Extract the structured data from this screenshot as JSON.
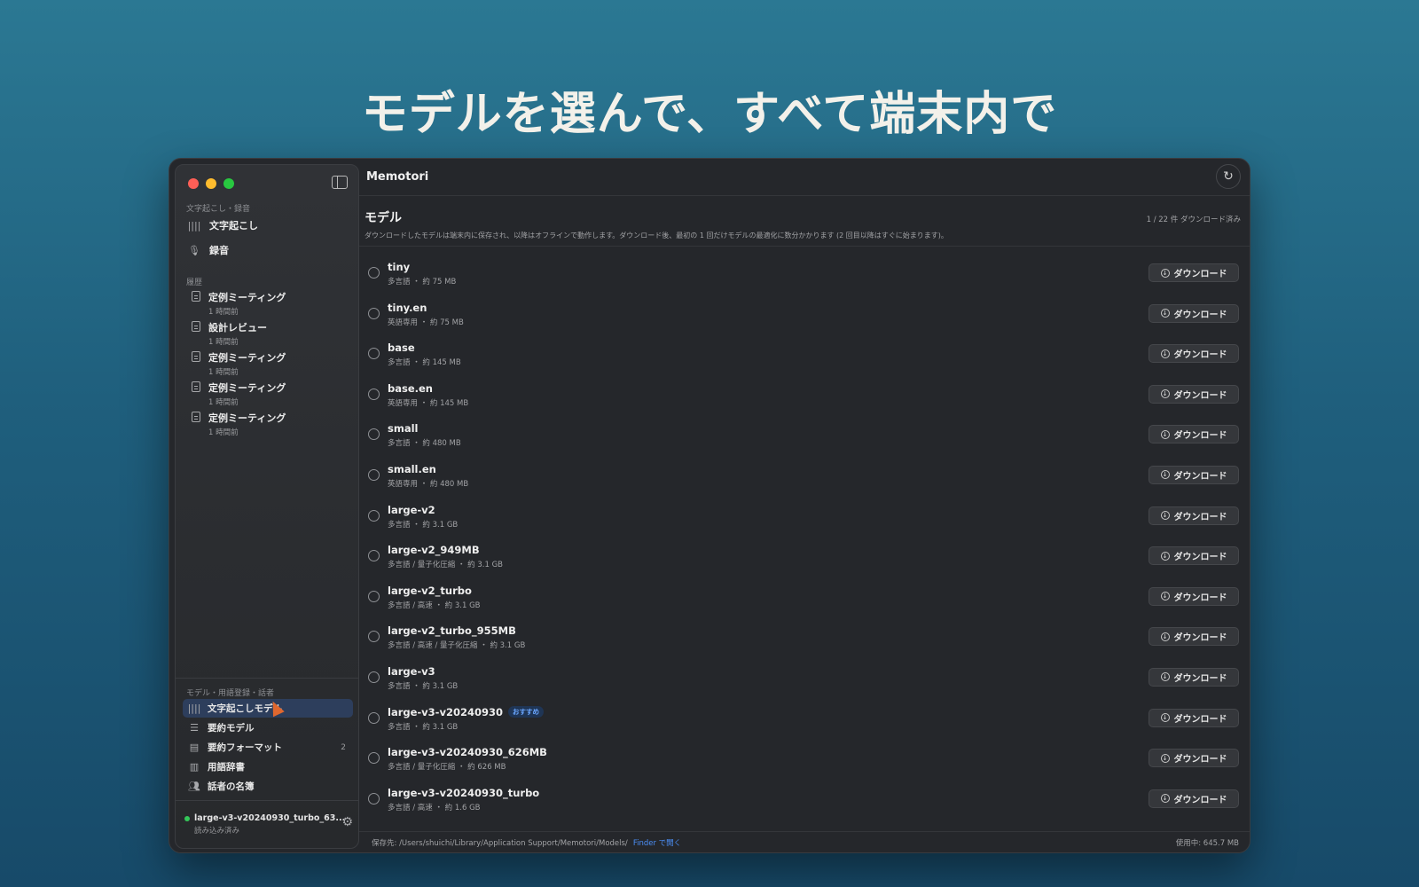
{
  "headline": "モデルを選んで、すべて端末内で",
  "app_title": "Memotori",
  "sidebar": {
    "section_transcribe": "文字起こし・録音",
    "nav": [
      {
        "label": "文字起こし",
        "icon": "waveform-icon"
      },
      {
        "label": "録音",
        "icon": "microphone-icon"
      }
    ],
    "section_history": "履歴",
    "history": [
      {
        "title": "定例ミーティング",
        "time": "1 時間前"
      },
      {
        "title": "設計レビュー",
        "time": "1 時間前"
      },
      {
        "title": "定例ミーティング",
        "time": "1 時間前"
      },
      {
        "title": "定例ミーティング",
        "time": "1 時間前"
      },
      {
        "title": "定例ミーティング",
        "time": "1 時間前"
      }
    ],
    "section_models": "モデル・用語登録・話者",
    "bottom": [
      {
        "label": "文字起こしモデル",
        "active": true
      },
      {
        "label": "要約モデル"
      },
      {
        "label": "要約フォーマット",
        "count": "2"
      },
      {
        "label": "用語辞書"
      },
      {
        "label": "話者の名簿"
      }
    ],
    "status": {
      "model": "large-v3-v20240930_turbo_63...",
      "state": "読み込み済み"
    }
  },
  "page": {
    "title": "モデル",
    "description": "ダウンロードしたモデルは端末内に保存され、以降はオフラインで動作します。ダウンロード後、最初の 1 回だけモデルの最適化に数分かかります (2 回目以降はすぐに始まります)。",
    "count": "1 / 22 件 ダウンロード済み",
    "download_label": "ダウンロード",
    "recommended_label": "おすすめ"
  },
  "models": [
    {
      "name": "tiny",
      "sub": "多言語 ・ 約 75 MB"
    },
    {
      "name": "tiny.en",
      "sub": "英語専用 ・ 約 75 MB"
    },
    {
      "name": "base",
      "sub": "多言語 ・ 約 145 MB"
    },
    {
      "name": "base.en",
      "sub": "英語専用 ・ 約 145 MB"
    },
    {
      "name": "small",
      "sub": "多言語 ・ 約 480 MB"
    },
    {
      "name": "small.en",
      "sub": "英語専用 ・ 約 480 MB"
    },
    {
      "name": "large-v2",
      "sub": "多言語 ・ 約 3.1 GB"
    },
    {
      "name": "large-v2_949MB",
      "sub": "多言語 / 量子化圧縮 ・ 約 3.1 GB"
    },
    {
      "name": "large-v2_turbo",
      "sub": "多言語 / 高速 ・ 約 3.1 GB"
    },
    {
      "name": "large-v2_turbo_955MB",
      "sub": "多言語 / 高速 / 量子化圧縮 ・ 約 3.1 GB"
    },
    {
      "name": "large-v3",
      "sub": "多言語 ・ 約 3.1 GB"
    },
    {
      "name": "large-v3-v20240930",
      "sub": "多言語 ・ 約 3.1 GB",
      "recommended": true
    },
    {
      "name": "large-v3-v20240930_626MB",
      "sub": "多言語 / 量子化圧縮 ・ 約 626 MB"
    },
    {
      "name": "large-v3-v20240930_turbo",
      "sub": "多言語 / 高速 ・ 約 1.6 GB"
    }
  ],
  "footer": {
    "path": "保存先: /Users/shuichi/Library/Application Support/Memotori/Models/",
    "finder": "Finder で開く",
    "usage": "使用中: 645.7 MB"
  }
}
